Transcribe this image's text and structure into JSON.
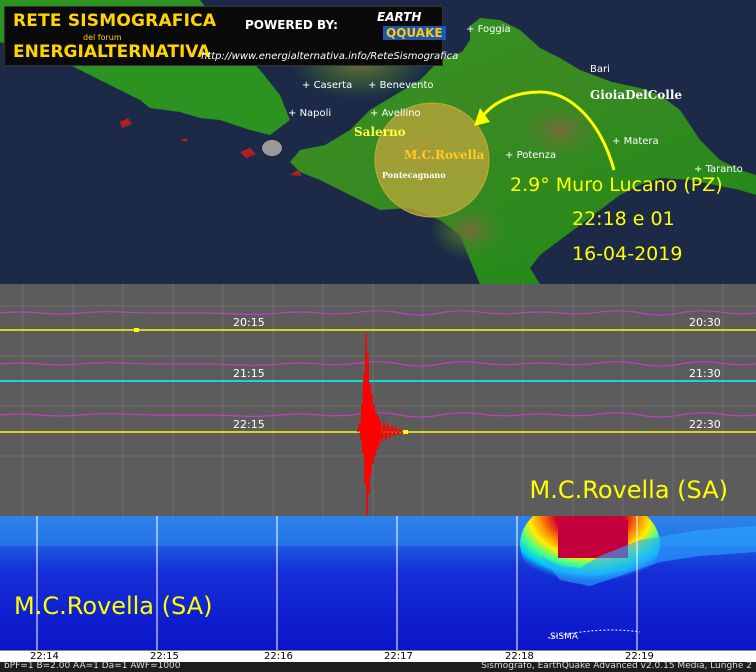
{
  "header": {
    "title": "RETE SISMOGRAFICA",
    "forum": "del forum",
    "subtitle": "ENERGIALTERNATIVA",
    "powered": "POWERED BY:",
    "logo_top": "EARTH",
    "logo_bottom": "QQUAKE",
    "url": "http://www.energialternativa.info/ReteSismografica"
  },
  "map": {
    "cities": [
      "Foggia",
      "Bari",
      "Caserta",
      "Benevento",
      "Napoli",
      "Avellino",
      "Potenza",
      "Matera",
      "Taranto"
    ],
    "highlight_salerno": "Salerno",
    "highlight_gioia": "GioiaDelColle",
    "station_name": "M.C.Rovella",
    "pontecagnano": "Pontecagnano",
    "quake_line1": "2.9° Muro Lucano (PZ)",
    "quake_line2": "22:18 e 01",
    "quake_line3": "16-04-2019",
    "colors": {
      "land": "#2f9a1f",
      "sea": "#1a2a4a",
      "circle": "#b8a63a",
      "arrow": "#ffff00"
    }
  },
  "seismogram": {
    "left_times": [
      "20:15",
      "21:15",
      "22:15"
    ],
    "right_times": [
      "20:30",
      "21:30",
      "22:30"
    ],
    "station": "M.C.Rovella (SA)"
  },
  "spectrogram": {
    "station": "M.C.Rovella (SA)",
    "event_label": "SISMA"
  },
  "axis": {
    "ticks": [
      "22:14",
      "22:15",
      "22:16",
      "22:17",
      "22:18",
      "22:19"
    ]
  },
  "status": {
    "left": "bPF=1 B=2.00 AA=1 Da=1 AWF=1000",
    "right": "Sismografo, EarthQuake Advanced v2.0.15  Media, Lunghe 2"
  }
}
